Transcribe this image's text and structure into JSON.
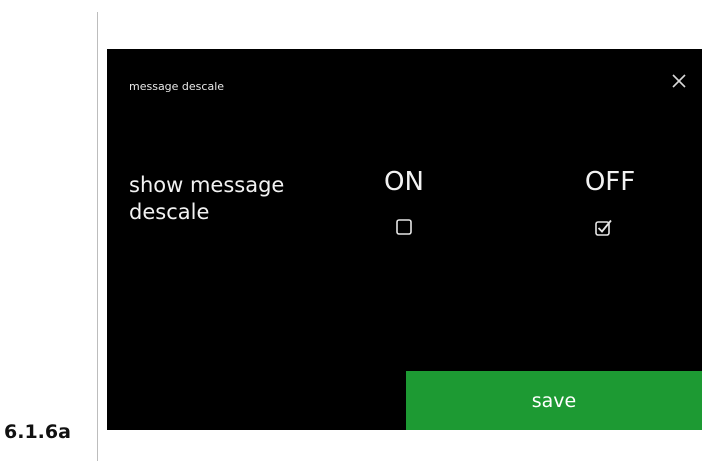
{
  "figure_label": "6.1.6a",
  "screen": {
    "title": "message descale",
    "setting_label": "show message descale",
    "option_on": "ON",
    "option_off": "OFF",
    "on_checked": false,
    "off_checked": true,
    "save_label": "save",
    "colors": {
      "background": "#000000",
      "text": "#f2f2f2",
      "save_button": "#1d9a33"
    },
    "icons": {
      "close": "close-icon",
      "unchecked": "checkbox-unchecked-icon",
      "checked": "checkbox-checked-icon"
    }
  }
}
